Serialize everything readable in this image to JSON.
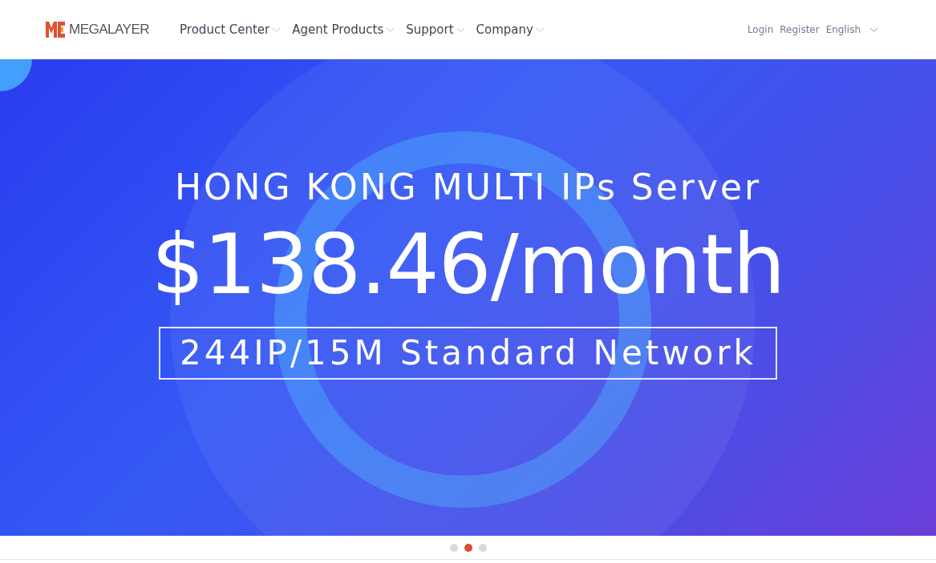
{
  "header": {
    "logo_text": "MEGALAYER",
    "nav": [
      {
        "label": "Product Center"
      },
      {
        "label": "Agent Products"
      },
      {
        "label": "Support"
      },
      {
        "label": "Company"
      }
    ],
    "account": {
      "login": "Login",
      "register": "Register",
      "language": "English"
    }
  },
  "banner": {
    "subtitle": "HONG KONG MULTI IPs Server",
    "price": "$138.46/month",
    "tagline": "244IP/15M Standard Network"
  },
  "carousel_dots": [
    {
      "selected": false
    },
    {
      "selected": true
    },
    {
      "selected": false
    }
  ]
}
